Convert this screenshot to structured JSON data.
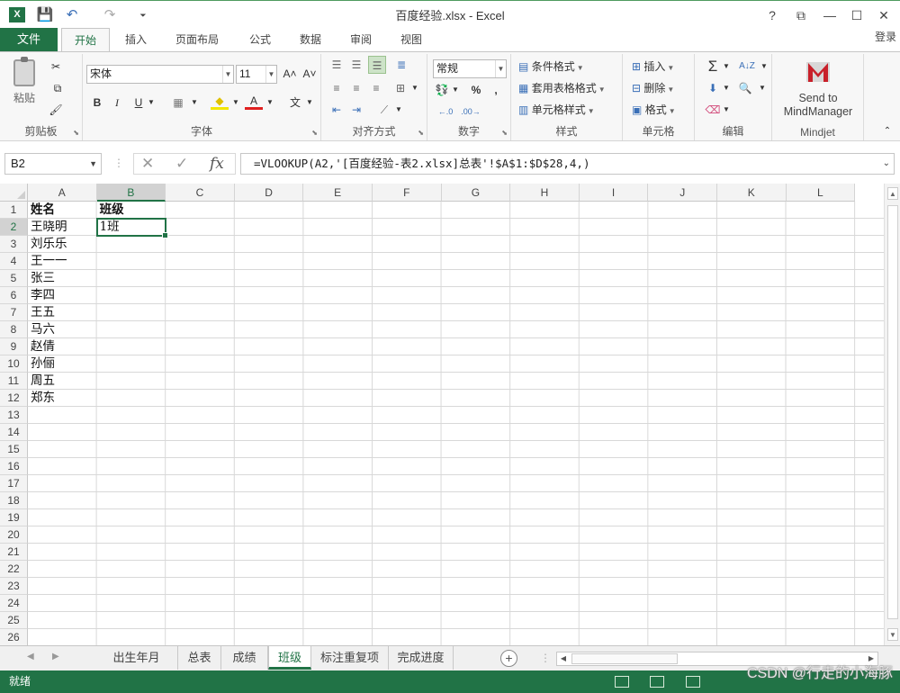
{
  "window": {
    "title": "百度经验.xlsx - Excel",
    "quick_access": {
      "save": "💾",
      "undo": "↶",
      "redo": "↷",
      "customize": "⏷"
    },
    "controls": {
      "help": "?",
      "ribbon_options": "⧉",
      "minimize": "—",
      "maximize": "☐",
      "close": "✕"
    }
  },
  "ribbon_tabs": {
    "file": "文件",
    "tabs": [
      "开始",
      "插入",
      "页面布局",
      "公式",
      "数据",
      "审阅",
      "视图"
    ],
    "active": "开始",
    "signin": "登录"
  },
  "ribbon": {
    "clipboard": {
      "label": "剪贴板",
      "paste": "粘贴",
      "cut_icon": "✂",
      "copy_icon": "⧉",
      "painter_icon": "🖌"
    },
    "font": {
      "label": "字体",
      "name": "宋体",
      "size": "11",
      "grow": "A˄",
      "shrink": "A˅",
      "bold": "B",
      "italic": "I",
      "underline": "U",
      "border_icon": "▦",
      "fill_icon": "◆",
      "color_icon": "A",
      "phonetic": "文"
    },
    "alignment": {
      "label": "对齐方式",
      "wrap_icon": "≣",
      "merge_icon": "⊞",
      "orient_icon": "⟋",
      "indent_dec": "⇤",
      "indent_inc": "⇥"
    },
    "number": {
      "label": "数字",
      "format": "常规",
      "currency_icon": "💱",
      "percent": "%",
      "comma": ",",
      "inc_dec": "←.0",
      "dec_dec": ".00→"
    },
    "styles": {
      "label": "样式",
      "conditional": "条件格式",
      "table": "套用表格格式",
      "cell": "单元格样式"
    },
    "cells": {
      "label": "单元格",
      "insert": "插入",
      "delete": "删除",
      "format": "格式"
    },
    "editing": {
      "label": "编辑",
      "sum_icon": "Σ",
      "sort_icon": "A↓Z",
      "find_icon": "🔍",
      "fill_icon": "⬇",
      "clear_icon": "⌫"
    },
    "mindjet": {
      "label": "Mindjet",
      "send_line1": "Send to",
      "send_line2": "MindManager"
    }
  },
  "formula_bar": {
    "name_box": "B2",
    "cancel": "✕",
    "enter": "✓",
    "fx": "fx",
    "formula": "=VLOOKUP(A2,'[百度经验-表2.xlsx]总表'!$A$1:$D$28,4,)"
  },
  "columns": [
    "A",
    "B",
    "C",
    "D",
    "E",
    "F",
    "G",
    "H",
    "I",
    "J",
    "K",
    "L"
  ],
  "active_column": "B",
  "rows": [
    "1",
    "2",
    "3",
    "4",
    "5",
    "6",
    "7",
    "8",
    "9",
    "10",
    "11",
    "12",
    "13",
    "14",
    "15",
    "16",
    "17",
    "18",
    "19",
    "20",
    "21",
    "22",
    "23",
    "24",
    "25",
    "26"
  ],
  "active_row": "2",
  "cells": {
    "A": [
      "姓名",
      "王晓明",
      "刘乐乐",
      "王一一",
      "张三",
      "李四",
      "王五",
      "马六",
      "赵倩",
      "孙俪",
      "周五",
      "郑东"
    ],
    "B": [
      "班级",
      "1班"
    ]
  },
  "sheet_tabs": {
    "tabs": [
      "出生年月",
      "总表",
      "成绩",
      "班级",
      "标注重复项",
      "完成进度"
    ],
    "active": "班级",
    "add": "+"
  },
  "status": {
    "text": "就绪"
  },
  "watermark": "CSDN @行走的小海豚"
}
